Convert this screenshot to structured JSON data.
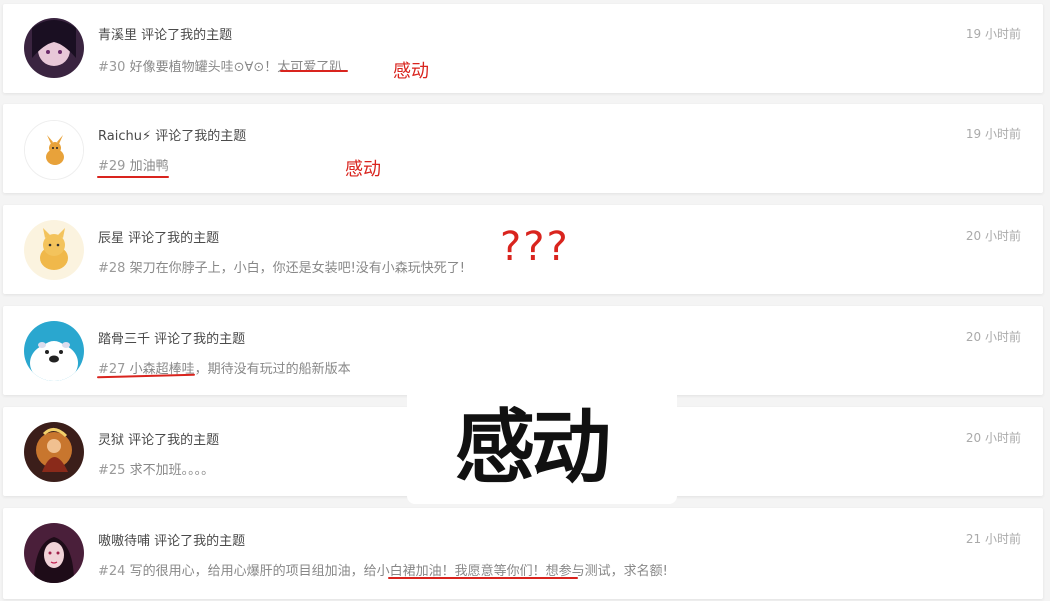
{
  "notifications": [
    {
      "user": "青溪里",
      "action": "评论了我的主题",
      "number": "#30",
      "message": "好像要植物罐头哇⊙∀⊙！太可爱了趴",
      "time": "19 小时前",
      "annotation": "感动"
    },
    {
      "user": "Raichu⚡",
      "action": "评论了我的主题",
      "number": "#29",
      "message": "加油鸭",
      "time": "19 小时前",
      "annotation": "感动"
    },
    {
      "user": "辰星",
      "action": "评论了我的主题",
      "number": "#28",
      "message": "架刀在你脖子上，小白，你还是女装吧!没有小森玩快死了!",
      "time": "20 小时前",
      "annotation": "???"
    },
    {
      "user": "踏骨三千",
      "action": "评论了我的主题",
      "number": "#27",
      "message": "小森超棒哇，期待没有玩过的船新版本",
      "time": "20 小时前",
      "annotation": ""
    },
    {
      "user": "灵狱",
      "action": "评论了我的主题",
      "number": "#25",
      "message": "求不加班。。。。",
      "time": "20 小时前",
      "annotation": ""
    },
    {
      "user": "嗷嗷待哺",
      "action": "评论了我的主题",
      "number": "#24",
      "message": "写的很用心，给用心爆肝的项目组加油，给小白裙加油！我愿意等你们！想参与测试，求名额!",
      "time": "21 小时前",
      "annotation": ""
    }
  ],
  "overlay_caption": "感动",
  "colors": {
    "accent_red": "#d9241e",
    "card_bg": "#ffffff",
    "page_bg": "#f4f4f4",
    "muted_text": "#888888"
  }
}
